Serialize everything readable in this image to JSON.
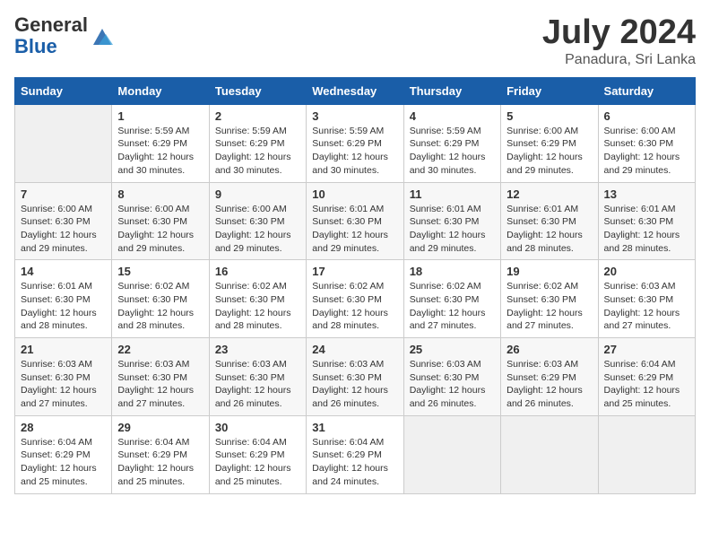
{
  "header": {
    "logo_general": "General",
    "logo_blue": "Blue",
    "month": "July 2024",
    "location": "Panadura, Sri Lanka"
  },
  "days_of_week": [
    "Sunday",
    "Monday",
    "Tuesday",
    "Wednesday",
    "Thursday",
    "Friday",
    "Saturday"
  ],
  "weeks": [
    [
      {
        "day": "",
        "info": ""
      },
      {
        "day": "1",
        "info": "Sunrise: 5:59 AM\nSunset: 6:29 PM\nDaylight: 12 hours\nand 30 minutes."
      },
      {
        "day": "2",
        "info": "Sunrise: 5:59 AM\nSunset: 6:29 PM\nDaylight: 12 hours\nand 30 minutes."
      },
      {
        "day": "3",
        "info": "Sunrise: 5:59 AM\nSunset: 6:29 PM\nDaylight: 12 hours\nand 30 minutes."
      },
      {
        "day": "4",
        "info": "Sunrise: 5:59 AM\nSunset: 6:29 PM\nDaylight: 12 hours\nand 30 minutes."
      },
      {
        "day": "5",
        "info": "Sunrise: 6:00 AM\nSunset: 6:29 PM\nDaylight: 12 hours\nand 29 minutes."
      },
      {
        "day": "6",
        "info": "Sunrise: 6:00 AM\nSunset: 6:30 PM\nDaylight: 12 hours\nand 29 minutes."
      }
    ],
    [
      {
        "day": "7",
        "info": "Sunrise: 6:00 AM\nSunset: 6:30 PM\nDaylight: 12 hours\nand 29 minutes."
      },
      {
        "day": "8",
        "info": "Sunrise: 6:00 AM\nSunset: 6:30 PM\nDaylight: 12 hours\nand 29 minutes."
      },
      {
        "day": "9",
        "info": "Sunrise: 6:00 AM\nSunset: 6:30 PM\nDaylight: 12 hours\nand 29 minutes."
      },
      {
        "day": "10",
        "info": "Sunrise: 6:01 AM\nSunset: 6:30 PM\nDaylight: 12 hours\nand 29 minutes."
      },
      {
        "day": "11",
        "info": "Sunrise: 6:01 AM\nSunset: 6:30 PM\nDaylight: 12 hours\nand 29 minutes."
      },
      {
        "day": "12",
        "info": "Sunrise: 6:01 AM\nSunset: 6:30 PM\nDaylight: 12 hours\nand 28 minutes."
      },
      {
        "day": "13",
        "info": "Sunrise: 6:01 AM\nSunset: 6:30 PM\nDaylight: 12 hours\nand 28 minutes."
      }
    ],
    [
      {
        "day": "14",
        "info": "Sunrise: 6:01 AM\nSunset: 6:30 PM\nDaylight: 12 hours\nand 28 minutes."
      },
      {
        "day": "15",
        "info": "Sunrise: 6:02 AM\nSunset: 6:30 PM\nDaylight: 12 hours\nand 28 minutes."
      },
      {
        "day": "16",
        "info": "Sunrise: 6:02 AM\nSunset: 6:30 PM\nDaylight: 12 hours\nand 28 minutes."
      },
      {
        "day": "17",
        "info": "Sunrise: 6:02 AM\nSunset: 6:30 PM\nDaylight: 12 hours\nand 28 minutes."
      },
      {
        "day": "18",
        "info": "Sunrise: 6:02 AM\nSunset: 6:30 PM\nDaylight: 12 hours\nand 27 minutes."
      },
      {
        "day": "19",
        "info": "Sunrise: 6:02 AM\nSunset: 6:30 PM\nDaylight: 12 hours\nand 27 minutes."
      },
      {
        "day": "20",
        "info": "Sunrise: 6:03 AM\nSunset: 6:30 PM\nDaylight: 12 hours\nand 27 minutes."
      }
    ],
    [
      {
        "day": "21",
        "info": "Sunrise: 6:03 AM\nSunset: 6:30 PM\nDaylight: 12 hours\nand 27 minutes."
      },
      {
        "day": "22",
        "info": "Sunrise: 6:03 AM\nSunset: 6:30 PM\nDaylight: 12 hours\nand 27 minutes."
      },
      {
        "day": "23",
        "info": "Sunrise: 6:03 AM\nSunset: 6:30 PM\nDaylight: 12 hours\nand 26 minutes."
      },
      {
        "day": "24",
        "info": "Sunrise: 6:03 AM\nSunset: 6:30 PM\nDaylight: 12 hours\nand 26 minutes."
      },
      {
        "day": "25",
        "info": "Sunrise: 6:03 AM\nSunset: 6:30 PM\nDaylight: 12 hours\nand 26 minutes."
      },
      {
        "day": "26",
        "info": "Sunrise: 6:03 AM\nSunset: 6:29 PM\nDaylight: 12 hours\nand 26 minutes."
      },
      {
        "day": "27",
        "info": "Sunrise: 6:04 AM\nSunset: 6:29 PM\nDaylight: 12 hours\nand 25 minutes."
      }
    ],
    [
      {
        "day": "28",
        "info": "Sunrise: 6:04 AM\nSunset: 6:29 PM\nDaylight: 12 hours\nand 25 minutes."
      },
      {
        "day": "29",
        "info": "Sunrise: 6:04 AM\nSunset: 6:29 PM\nDaylight: 12 hours\nand 25 minutes."
      },
      {
        "day": "30",
        "info": "Sunrise: 6:04 AM\nSunset: 6:29 PM\nDaylight: 12 hours\nand 25 minutes."
      },
      {
        "day": "31",
        "info": "Sunrise: 6:04 AM\nSunset: 6:29 PM\nDaylight: 12 hours\nand 24 minutes."
      },
      {
        "day": "",
        "info": ""
      },
      {
        "day": "",
        "info": ""
      },
      {
        "day": "",
        "info": ""
      }
    ]
  ]
}
